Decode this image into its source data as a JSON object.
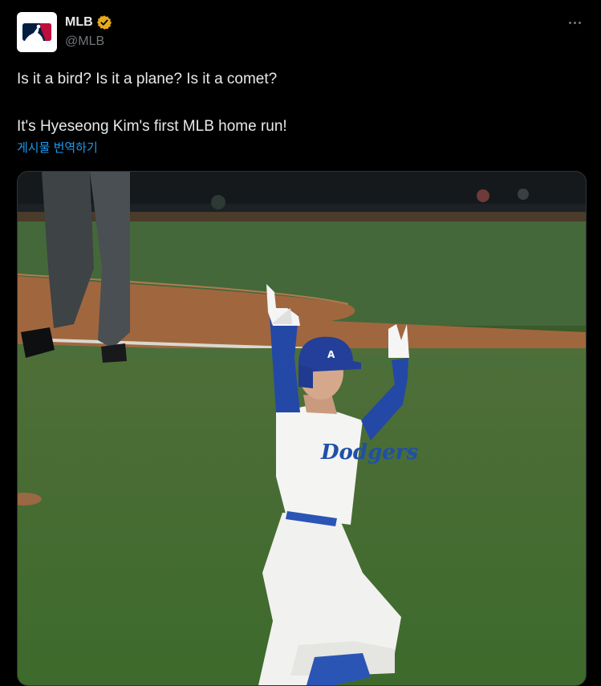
{
  "account": {
    "display_name": "MLB",
    "handle": "@MLB",
    "verified": true,
    "badge_color": "#e8a91a"
  },
  "tweet": {
    "line1": "Is it a bird? Is it a plane? Is it a comet?",
    "line2": "It's Hyeseong Kim's first MLB home run!",
    "translate_label": "게시물 번역하기"
  },
  "media": {
    "type": "video-still",
    "subject": "baseball player rounding bases with arms raised",
    "jersey_text": "Dodgers"
  },
  "icons": {
    "avatar": "mlb-logo-icon",
    "badge": "verified-badge-icon",
    "more": "more-options-icon"
  },
  "colors": {
    "background": "#000000",
    "text_primary": "#e7e9ea",
    "text_secondary": "#71767b",
    "link": "#1d9bf0"
  }
}
